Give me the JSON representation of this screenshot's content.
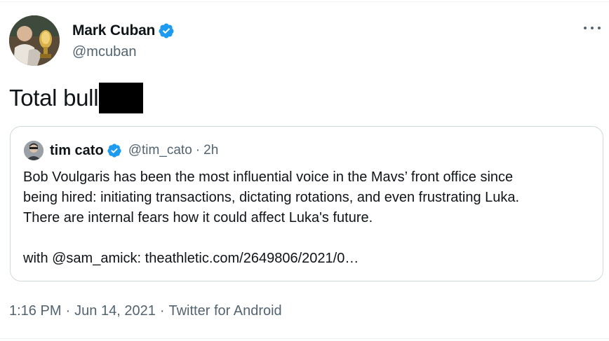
{
  "tweet": {
    "author": {
      "display_name": "Mark Cuban",
      "handle": "@mcuban",
      "verified_icon": "verified-badge-icon",
      "avatar_icon": "avatar"
    },
    "menu_icon": "more-options-icon",
    "text": "Total bull",
    "redaction_color": "#000000",
    "quoted": {
      "display_name": "tim cato",
      "handle": "@tim_cato",
      "separator": "·",
      "time": "2h",
      "lines": [
        "Bob Voulgaris has been the most influential voice in the Mavs’ front office since",
        "being hired: initiating transactions, dictating rotations, and even frustrating Luka.",
        "There are internal fears how it could affect Luka's future."
      ],
      "link_line": "with @sam_amick: theathletic.com/2649806/2021/0…"
    },
    "meta": {
      "time": "1:16 PM",
      "separator": "·",
      "date": "Jun 14, 2021",
      "source": "Twitter for Android"
    },
    "colors": {
      "text": "#0f1419",
      "secondary": "#536471",
      "verified": "#1d9bf0",
      "border": "#cfd9de"
    }
  }
}
